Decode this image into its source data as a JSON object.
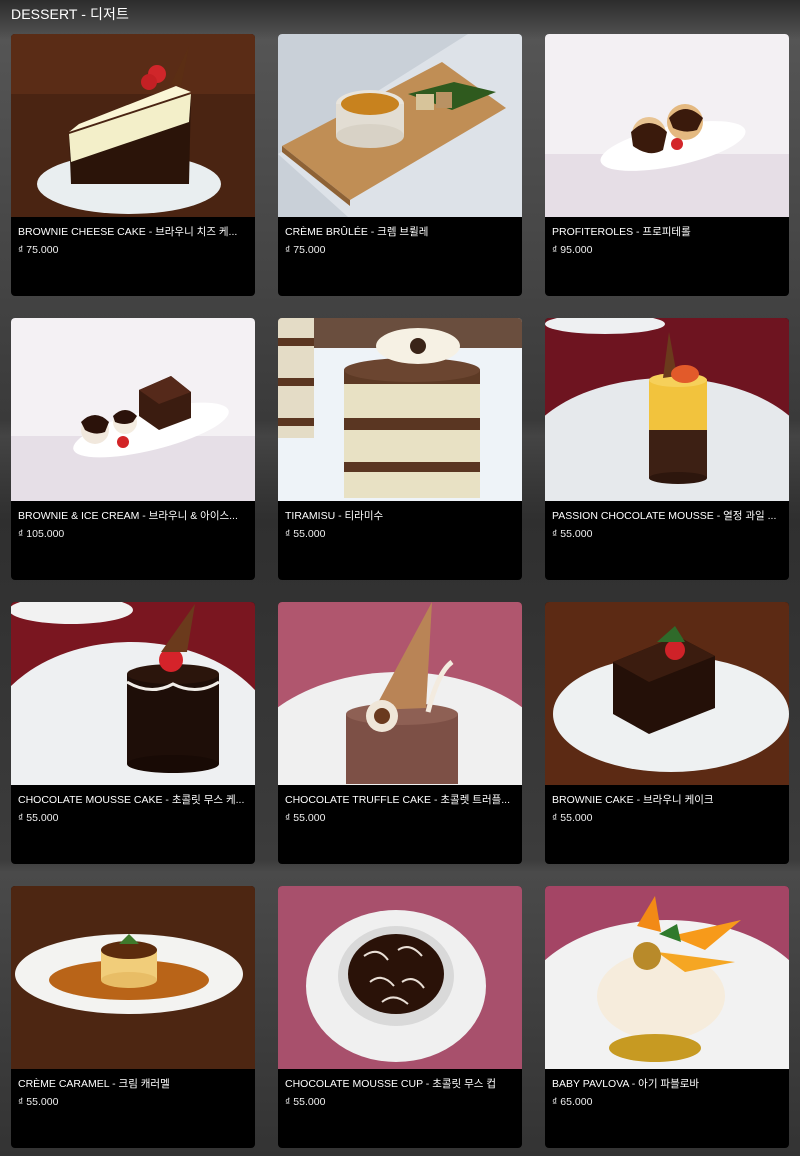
{
  "section": {
    "title": "DESSERT - 디저트"
  },
  "items": [
    {
      "name": "BROWNIE CHEESE CAKE - 브라우니 치즈 케...",
      "price": "₫ 75.000"
    },
    {
      "name": "CRÈME BRÛLÉE - 크렘 브륄레",
      "price": "₫ 75.000"
    },
    {
      "name": "PROFITEROLES - 프로피테롤",
      "price": "₫ 95.000"
    },
    {
      "name": "BROWNIE & ICE CREAM - 브라우니 & 아이스...",
      "price": "₫ 105.000"
    },
    {
      "name": "TIRAMISU - 티라미수",
      "price": "₫ 55.000"
    },
    {
      "name": "PASSION CHOCOLATE MOUSSE - 열정 과일 ...",
      "price": "₫ 55.000"
    },
    {
      "name": "CHOCOLATE MOUSSE CAKE - 초콜릿 무스 케...",
      "price": "₫ 55.000"
    },
    {
      "name": "CHOCOLATE TRUFFLE CAKE - 초콜렛 트러플...",
      "price": "₫ 55.000"
    },
    {
      "name": "BROWNIE CAKE - 브라우니 케이크",
      "price": "₫ 55.000"
    },
    {
      "name": "CRÈME CARAMEL - 크림 캐러멜",
      "price": "₫ 55.000"
    },
    {
      "name": "CHOCOLATE MOUSSE CUP - 초콜릿 무스 컵",
      "price": "₫ 55.000"
    },
    {
      "name": "BABY PAVLOVA - 아기 파블로바",
      "price": "₫ 65.000"
    }
  ]
}
